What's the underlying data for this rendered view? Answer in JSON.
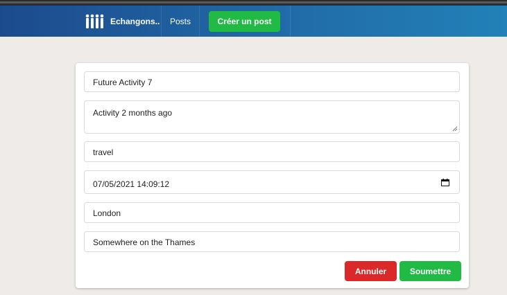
{
  "navbar": {
    "brand": "Echangons..",
    "posts_link": "Posts",
    "create_button": "Créer un post"
  },
  "form": {
    "title_value": "Future Activity 7",
    "description_value": "Activity 2 months ago",
    "category_value": "travel",
    "date_value": "07/05/2021 14:09:12",
    "city_value": "London",
    "venue_value": "Somewhere on the Thames",
    "cancel_button": "Annuler",
    "submit_button": "Soumettre"
  },
  "icons": {
    "brand_logo": "people-logo-icon",
    "date_picker": "calendar-icon",
    "textarea_resize": "resize-handle-icon"
  },
  "colors": {
    "navbar_start": "#1c4b8c",
    "navbar_end": "#2281b8",
    "positive": "#21ba45",
    "negative": "#db2828",
    "background": "#eeebe8"
  }
}
